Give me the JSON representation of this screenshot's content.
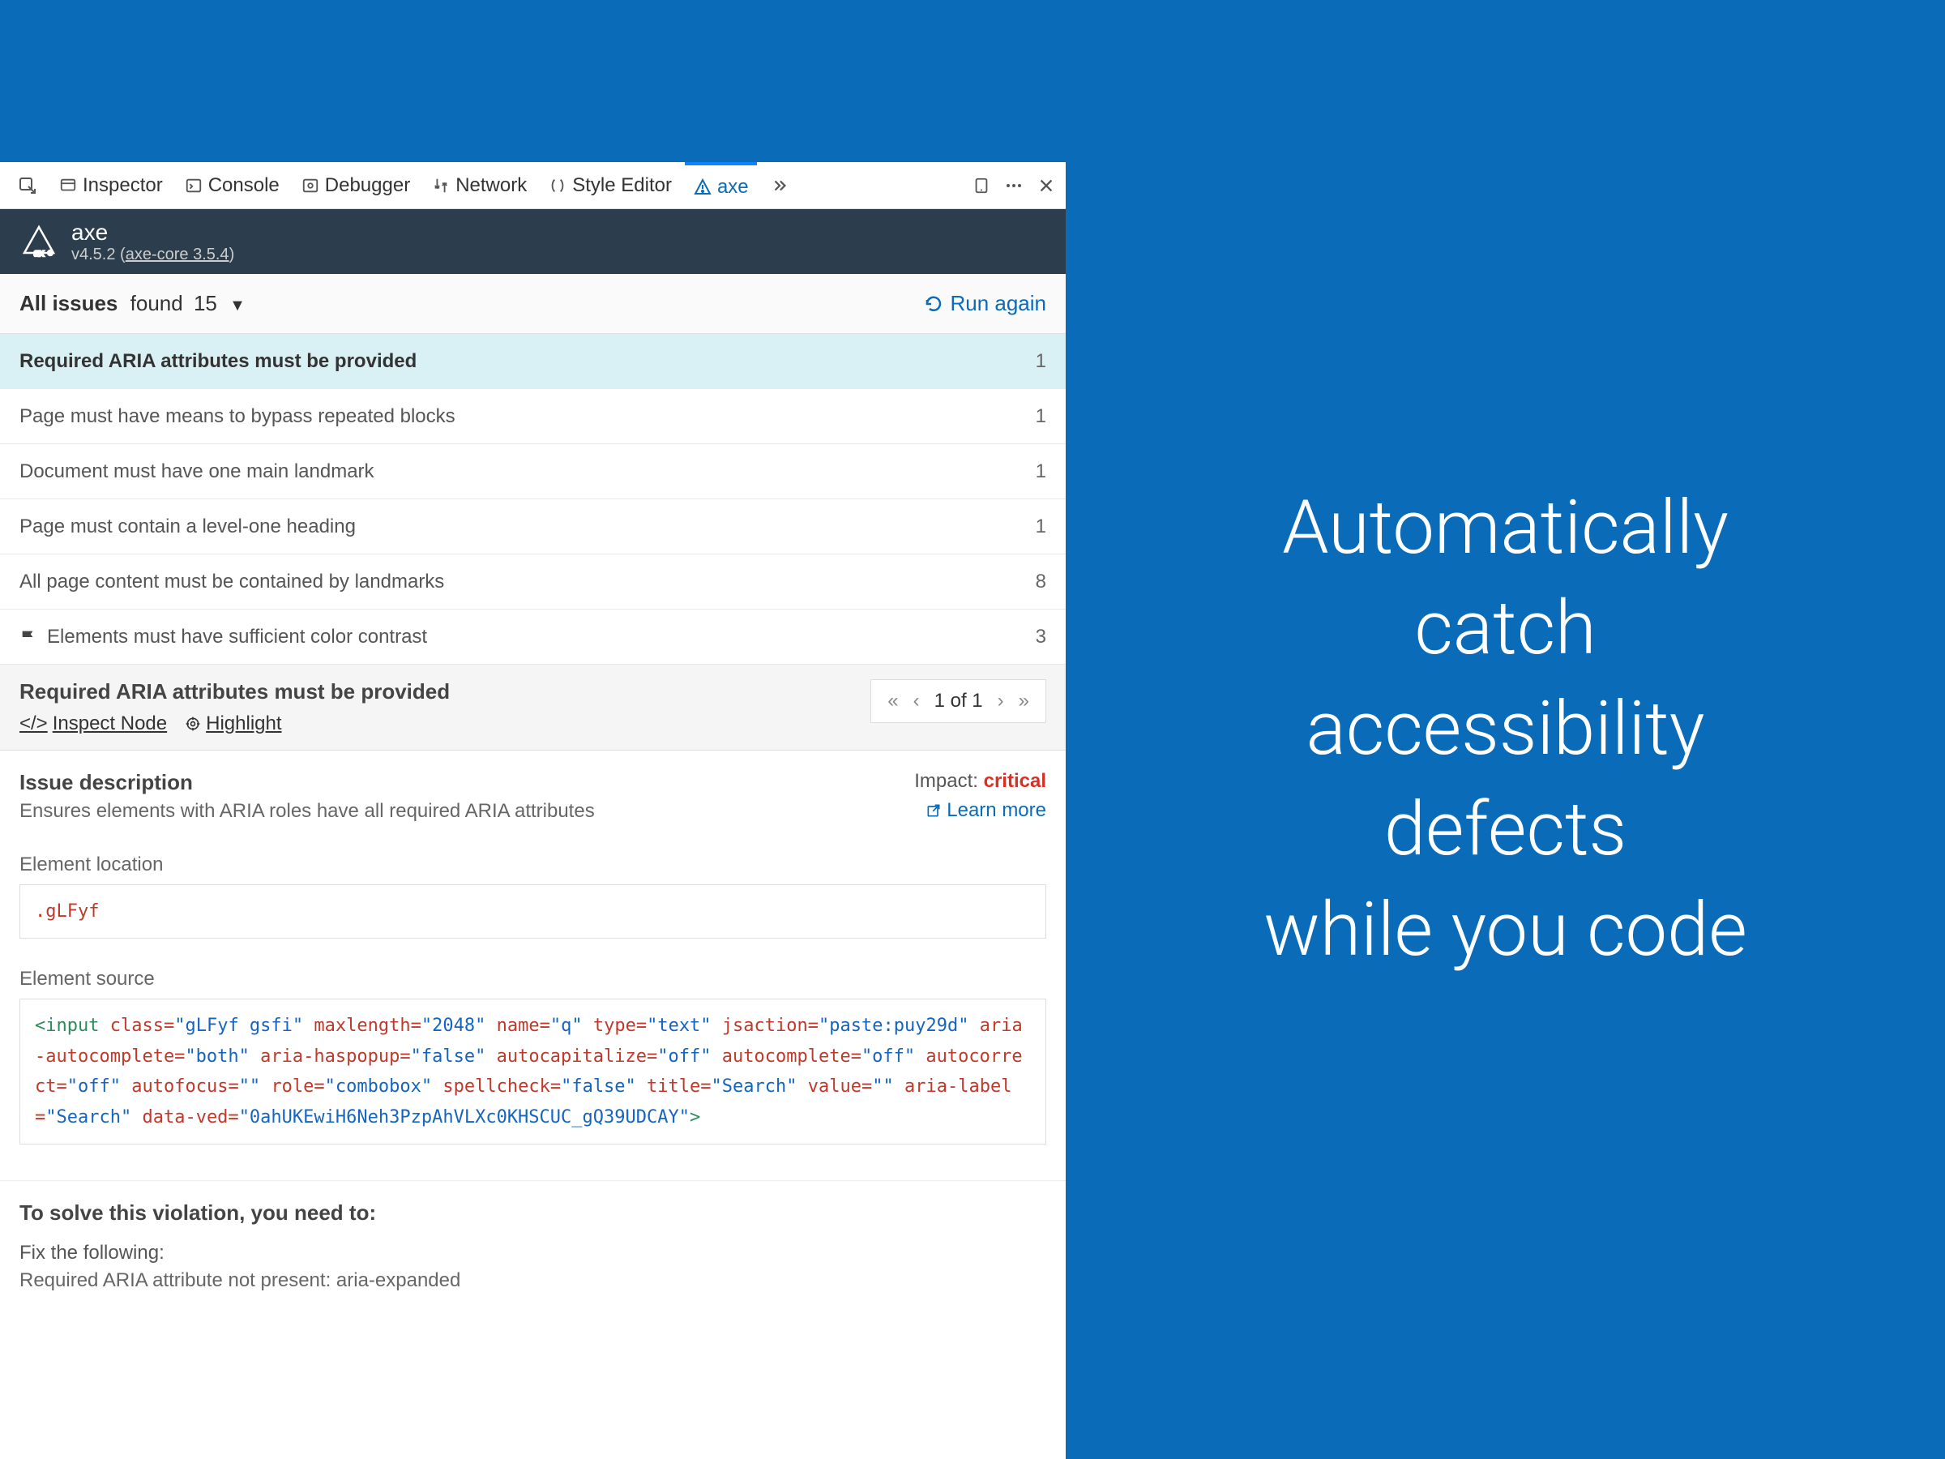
{
  "devtools_tabs": {
    "inspector": "Inspector",
    "console": "Console",
    "debugger": "Debugger",
    "network": "Network",
    "style_editor": "Style Editor",
    "axe": "axe"
  },
  "axe_header": {
    "title": "axe",
    "version_prefix": "v4.5.2 (",
    "version_link": "axe-core 3.5.4",
    "version_suffix": ")"
  },
  "issues_bar": {
    "label": "All issues",
    "sublabel": "found",
    "count": "15",
    "run_again": "Run again"
  },
  "issues": [
    {
      "title": "Required ARIA attributes must be provided",
      "count": "1",
      "selected": true
    },
    {
      "title": "Page must have means to bypass repeated blocks",
      "count": "1"
    },
    {
      "title": "Document must have one main landmark",
      "count": "1"
    },
    {
      "title": "Page must contain a level-one heading",
      "count": "1"
    },
    {
      "title": "All page content must be contained by landmarks",
      "count": "8"
    },
    {
      "title": "Elements must have sufficient color contrast",
      "count": "3",
      "flag": true
    }
  ],
  "detail": {
    "title": "Required ARIA attributes must be provided",
    "inspect_node": "Inspect Node",
    "highlight": "Highlight",
    "pager": "1 of 1",
    "issue_description_label": "Issue description",
    "issue_description_text": "Ensures elements with ARIA roles have all required ARIA attributes",
    "impact_label": "Impact:",
    "impact_value": "critical",
    "learn_more": "Learn more",
    "element_location_label": "Element location",
    "element_location_value": ".gLFyf",
    "element_source_label": "Element source",
    "element_source_html": "<input class=\"gLFyf gsfi\" maxlength=\"2048\" name=\"q\" type=\"text\" jsaction=\"paste:puy29d\" aria-autocomplete=\"both\" aria-haspopup=\"false\" autocapitalize=\"off\" autocomplete=\"off\" autocorrect=\"off\" autofocus=\"\" role=\"combobox\" spellcheck=\"false\" title=\"Search\" value=\"\" aria-label=\"Search\" data-ved=\"0ahUKEwiH6Neh3PzpAhVLXc0KHSCUC_gQ39UDCAY\">",
    "solve_title": "To solve this violation, you need to:",
    "solve_sub": "Fix the following:",
    "solve_text": "Required ARIA attribute not present: aria-expanded"
  },
  "headline": {
    "line1": "Automatically",
    "line2": "catch",
    "line3": "accessibility",
    "line4": "defects",
    "line5": "while you code"
  }
}
